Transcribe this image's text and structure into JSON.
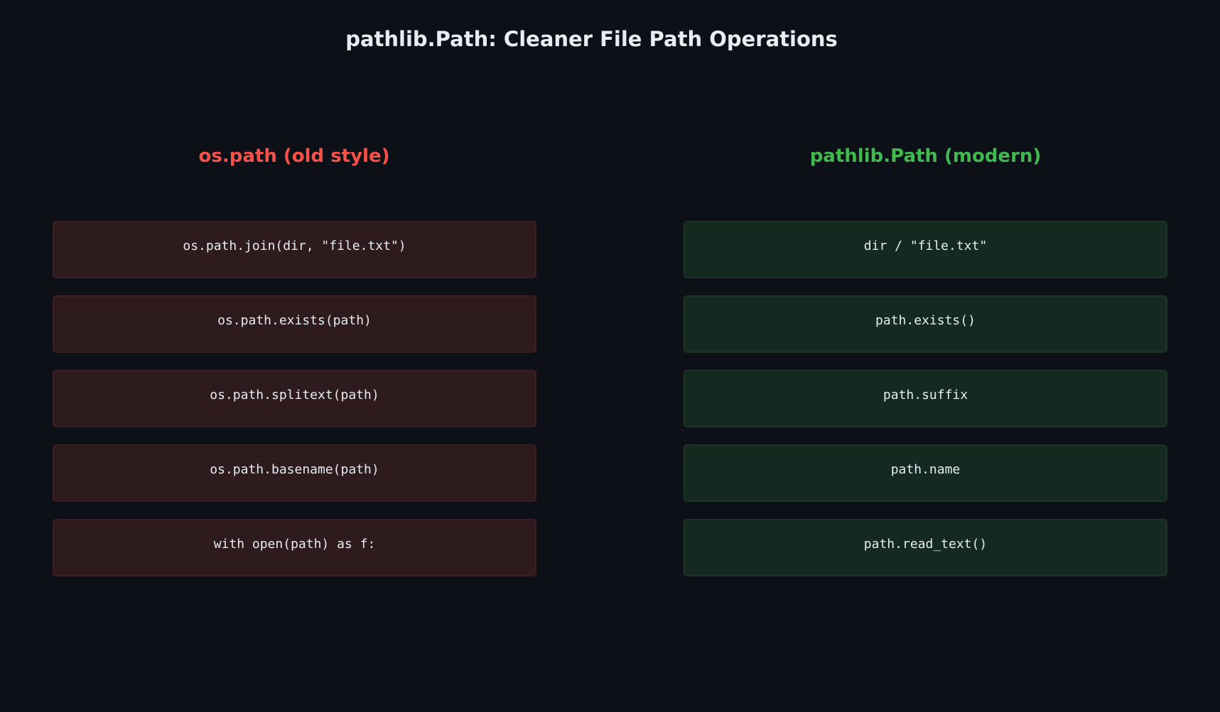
{
  "title": "pathlib.Path: Cleaner File Path Operations",
  "colors": {
    "background": "#0d1117",
    "old_accent": "#f85149",
    "new_accent": "#3fb950",
    "old_box": "#2e1b1e",
    "new_box": "#142920",
    "text": "#e6edf3"
  },
  "old_column": {
    "heading": "os.path (old style)",
    "items": [
      "os.path.join(dir, \"file.txt\")",
      "os.path.exists(path)",
      "os.path.splitext(path)",
      "os.path.basename(path)",
      "with open(path) as f:"
    ]
  },
  "new_column": {
    "heading": "pathlib.Path (modern)",
    "items": [
      "dir / \"file.txt\"",
      "path.exists()",
      "path.suffix",
      "path.name",
      "path.read_text()"
    ]
  }
}
